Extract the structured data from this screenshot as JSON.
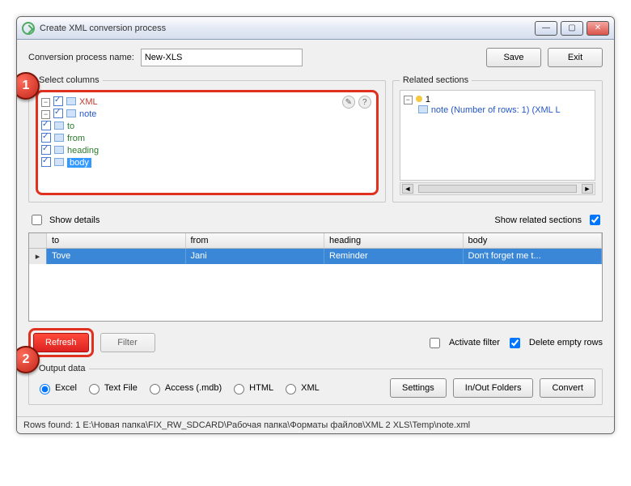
{
  "window": {
    "title": "Create XML conversion process"
  },
  "header": {
    "name_label": "Conversion process name:",
    "name_value": "New-XLS",
    "save": "Save",
    "exit": "Exit"
  },
  "columns": {
    "legend": "Select columns",
    "root": "XML",
    "note": "note",
    "leaves": {
      "to": "to",
      "from": "from",
      "heading": "heading",
      "body": "body"
    }
  },
  "related": {
    "legend": "Related sections",
    "root": "1",
    "child": "note (Number of rows: 1) (XML L"
  },
  "checks": {
    "show_details": "Show details",
    "show_related": "Show related sections"
  },
  "grid": {
    "headers": {
      "to": "to",
      "from": "from",
      "heading": "heading",
      "body": "body"
    },
    "row": {
      "to": "Tove",
      "from": "Jani",
      "heading": "Reminder",
      "body": "Don't forget me t..."
    }
  },
  "actions": {
    "refresh": "Refresh",
    "filter": "Filter",
    "activate_filter": "Activate filter",
    "delete_empty": "Delete empty rows"
  },
  "output": {
    "legend": "Output data",
    "excel": "Excel",
    "text": "Text File",
    "access": "Access (.mdb)",
    "html": "HTML",
    "xml": "XML",
    "settings": "Settings",
    "inout": "In/Out Folders",
    "convert": "Convert"
  },
  "status": "Rows found: 1   E:\\Новая папка\\FIX_RW_SDCARD\\Рабочая папка\\Форматы файлов\\XML 2 XLS\\Temp\\note.xml",
  "callouts": {
    "c1": "1",
    "c2": "2"
  }
}
